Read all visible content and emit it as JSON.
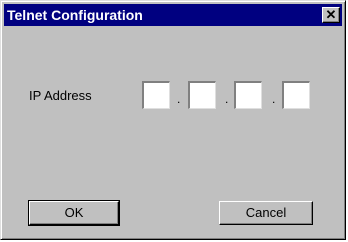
{
  "window": {
    "title": "Telnet Configuration",
    "close_glyph": "✕"
  },
  "form": {
    "ip_label": "IP Address",
    "ip_octets": [
      "",
      "",
      "",
      ""
    ],
    "ip_separator": "."
  },
  "buttons": {
    "ok_label": "OK",
    "cancel_label": "Cancel"
  }
}
